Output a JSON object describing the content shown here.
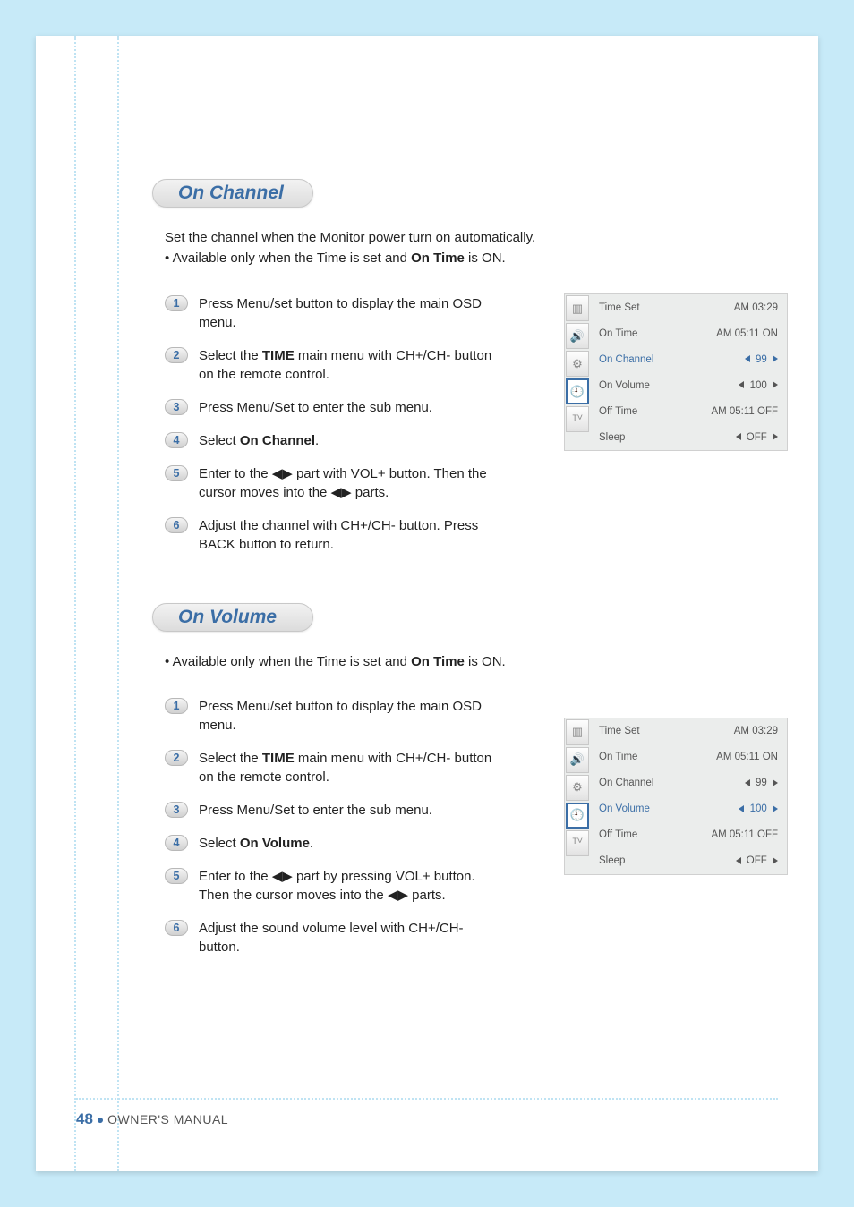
{
  "section1": {
    "title": "On Channel",
    "intro_line1": "Set the channel when the Monitor power turn on automatically.",
    "intro_line2_pre": "• Available only when the Time is set and ",
    "intro_line2_bold": "On Time",
    "intro_line2_post": " is ON.",
    "steps": [
      {
        "n": "1",
        "text": "Press Menu/set button to display the main OSD menu."
      },
      {
        "n": "2",
        "pre": "Select the ",
        "bold": "TIME",
        "post": " main menu with CH+/CH- button on the remote control."
      },
      {
        "n": "3",
        "text": "Press Menu/Set to enter the sub menu."
      },
      {
        "n": "4",
        "pre": "Select ",
        "bold": "On Channel",
        "post": "."
      },
      {
        "n": "5",
        "text": "Enter to the ◀▶ part with VOL+  button. Then the cursor moves into the ◀▶ parts."
      },
      {
        "n": "6",
        "text": "Adjust the channel with CH+/CH- button. Press BACK button to return."
      }
    ],
    "osd": {
      "highlight": 2,
      "rows": [
        {
          "label": "Time Set",
          "value": "AM 03:29",
          "arrows": false
        },
        {
          "label": "On Time",
          "value": "AM 05:11 ON",
          "arrows": false
        },
        {
          "label": "On Channel",
          "value": "99",
          "arrows": true
        },
        {
          "label": "On Volume",
          "value": "100",
          "arrows": true
        },
        {
          "label": "Off Time",
          "value": "AM 05:11 OFF",
          "arrows": false
        },
        {
          "label": "Sleep",
          "value": "OFF",
          "arrows": true
        }
      ]
    }
  },
  "section2": {
    "title": "On Volume",
    "intro_line2_pre": "• Available only when the Time is set and ",
    "intro_line2_bold": "On Time",
    "intro_line2_post": " is ON.",
    "steps": [
      {
        "n": "1",
        "text": "Press Menu/set button to display the main OSD menu."
      },
      {
        "n": "2",
        "pre": "Select the ",
        "bold": "TIME",
        "post": " main menu with CH+/CH- button on the remote control."
      },
      {
        "n": "3",
        "text": "Press Menu/Set to enter the sub menu."
      },
      {
        "n": "4",
        "pre": "Select ",
        "bold": "On Volume",
        "post": "."
      },
      {
        "n": "5",
        "text": "Enter to the ◀▶ part by pressing VOL+ button. Then the cursor moves into the ◀▶ parts."
      },
      {
        "n": "6",
        "text": "Adjust the sound volume level with CH+/CH- button."
      }
    ],
    "osd": {
      "highlight": 3,
      "rows": [
        {
          "label": "Time Set",
          "value": "AM 03:29",
          "arrows": false
        },
        {
          "label": "On Time",
          "value": "AM 05:11 ON",
          "arrows": false
        },
        {
          "label": "On Channel",
          "value": "99",
          "arrows": true
        },
        {
          "label": "On Volume",
          "value": "100",
          "arrows": true
        },
        {
          "label": "Off Time",
          "value": "AM 05:11 OFF",
          "arrows": false
        },
        {
          "label": "Sleep",
          "value": "OFF",
          "arrows": true
        }
      ]
    }
  },
  "osd_icons": [
    "▥",
    "🔊",
    "⚙",
    "🕘",
    "ᵀⱽ"
  ],
  "osd_selected_icon": 3,
  "footer": {
    "page": "48",
    "label": "OWNER'S MANUAL"
  }
}
